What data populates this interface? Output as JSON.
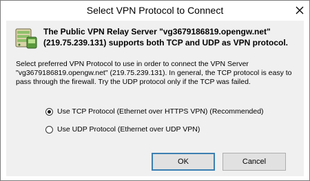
{
  "window": {
    "title": "Select VPN Protocol to Connect",
    "close_icon": "close-icon"
  },
  "dialog": {
    "icon": "vpn-server-icon",
    "headline": "The Public VPN Relay Server \"vg3679186819.opengw.net\" (219.75.239.131) supports both TCP and UDP as VPN protocol.",
    "description": "Select preferred VPN Protocol to use in order to connect the VPN Server \"vg3679186819.opengw.net\" (219.75.239.131). In general, the TCP protocol is easy to pass through the firewall. Try the UDP protocol only if the TCP was failed.",
    "options": [
      {
        "label": "Use TCP Protocol (Ethernet over HTTPS VPN) (Recommended)",
        "selected": true
      },
      {
        "label": "Use UDP Protocol (Ethernet over UDP VPN)",
        "selected": false
      }
    ],
    "ok_label": "OK",
    "cancel_label": "Cancel"
  },
  "colors": {
    "dialog_background": "#f0f0f0",
    "default_button_border": "#3c7fb1"
  }
}
